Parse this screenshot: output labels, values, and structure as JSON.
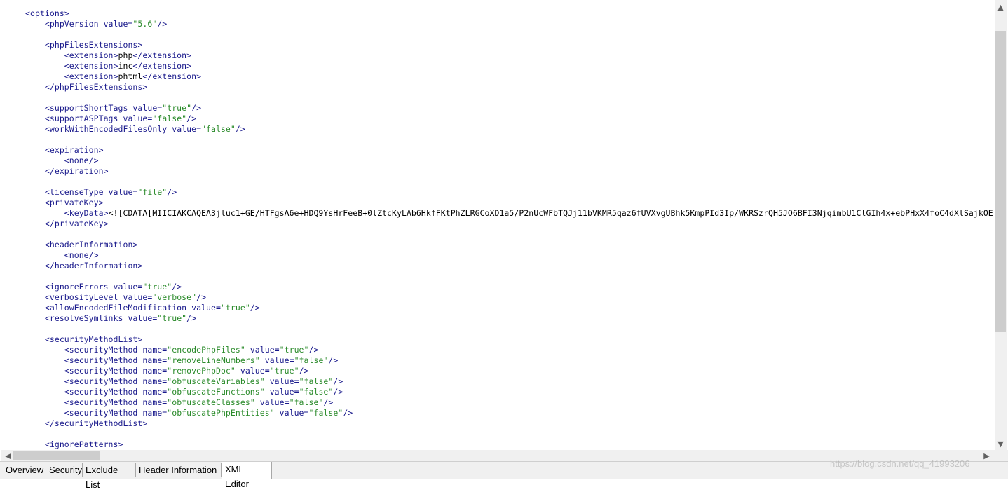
{
  "xml_lines": [
    [
      {
        "c": "t",
        "s": "<options>"
      }
    ],
    [
      {
        "c": "t",
        "s": "    <phpVersion "
      },
      {
        "c": "t",
        "s": "value="
      },
      {
        "c": "v",
        "s": "\"5.6\""
      },
      {
        "c": "t",
        "s": "/>"
      }
    ],
    [],
    [
      {
        "c": "t",
        "s": "    <phpFilesExtensions>"
      }
    ],
    [
      {
        "c": "t",
        "s": "        <extension>"
      },
      {
        "c": "txt",
        "s": "php"
      },
      {
        "c": "t",
        "s": "</extension>"
      }
    ],
    [
      {
        "c": "t",
        "s": "        <extension>"
      },
      {
        "c": "txt",
        "s": "inc"
      },
      {
        "c": "t",
        "s": "</extension>"
      }
    ],
    [
      {
        "c": "t",
        "s": "        <extension>"
      },
      {
        "c": "txt",
        "s": "phtml"
      },
      {
        "c": "t",
        "s": "</extension>"
      }
    ],
    [
      {
        "c": "t",
        "s": "    </phpFilesExtensions>"
      }
    ],
    [],
    [
      {
        "c": "t",
        "s": "    <supportShortTags "
      },
      {
        "c": "t",
        "s": "value="
      },
      {
        "c": "v",
        "s": "\"true\""
      },
      {
        "c": "t",
        "s": "/>"
      }
    ],
    [
      {
        "c": "t",
        "s": "    <supportASPTags "
      },
      {
        "c": "t",
        "s": "value="
      },
      {
        "c": "v",
        "s": "\"false\""
      },
      {
        "c": "t",
        "s": "/>"
      }
    ],
    [
      {
        "c": "t",
        "s": "    <workWithEncodedFilesOnly "
      },
      {
        "c": "t",
        "s": "value="
      },
      {
        "c": "v",
        "s": "\"false\""
      },
      {
        "c": "t",
        "s": "/>"
      }
    ],
    [],
    [
      {
        "c": "t",
        "s": "    <expiration>"
      }
    ],
    [
      {
        "c": "t",
        "s": "        <none/>"
      }
    ],
    [
      {
        "c": "t",
        "s": "    </expiration>"
      }
    ],
    [],
    [
      {
        "c": "t",
        "s": "    <licenseType "
      },
      {
        "c": "t",
        "s": "value="
      },
      {
        "c": "v",
        "s": "\"file\""
      },
      {
        "c": "t",
        "s": "/>"
      }
    ],
    [
      {
        "c": "t",
        "s": "    <privateKey>"
      }
    ],
    [
      {
        "c": "t",
        "s": "        <keyData>"
      },
      {
        "c": "txt",
        "s": "<![CDATA[MIICIAKCAQEA3jluc1+GE/HTFgsA6e+HDQ9YsHrFeeB+0lZtcKyLAb6HkfFKtPhZLRGCoXD1a5/P2nUcWFbTQJj11bVKMR5qaz6fUVXvgUBhk5KmpPId3Ip/WKRSzrQH5JO6BFI3NjqimbU1ClGIh4x+ebPHxX4foC4dXlSajkOE"
      }
    ],
    [
      {
        "c": "t",
        "s": "    </privateKey>"
      }
    ],
    [],
    [
      {
        "c": "t",
        "s": "    <headerInformation>"
      }
    ],
    [
      {
        "c": "t",
        "s": "        <none/>"
      }
    ],
    [
      {
        "c": "t",
        "s": "    </headerInformation>"
      }
    ],
    [],
    [
      {
        "c": "t",
        "s": "    <ignoreErrors "
      },
      {
        "c": "t",
        "s": "value="
      },
      {
        "c": "v",
        "s": "\"true\""
      },
      {
        "c": "t",
        "s": "/>"
      }
    ],
    [
      {
        "c": "t",
        "s": "    <verbosityLevel "
      },
      {
        "c": "t",
        "s": "value="
      },
      {
        "c": "v",
        "s": "\"verbose\""
      },
      {
        "c": "t",
        "s": "/>"
      }
    ],
    [
      {
        "c": "t",
        "s": "    <allowEncodedFileModification "
      },
      {
        "c": "t",
        "s": "value="
      },
      {
        "c": "v",
        "s": "\"true\""
      },
      {
        "c": "t",
        "s": "/>"
      }
    ],
    [
      {
        "c": "t",
        "s": "    <resolveSymlinks "
      },
      {
        "c": "t",
        "s": "value="
      },
      {
        "c": "v",
        "s": "\"true\""
      },
      {
        "c": "t",
        "s": "/>"
      }
    ],
    [],
    [
      {
        "c": "t",
        "s": "    <securityMethodList>"
      }
    ],
    [
      {
        "c": "t",
        "s": "        <securityMethod "
      },
      {
        "c": "t",
        "s": "name="
      },
      {
        "c": "v",
        "s": "\"encodePhpFiles\""
      },
      {
        "c": "t",
        "s": " value="
      },
      {
        "c": "v",
        "s": "\"true\""
      },
      {
        "c": "t",
        "s": "/>"
      }
    ],
    [
      {
        "c": "t",
        "s": "        <securityMethod "
      },
      {
        "c": "t",
        "s": "name="
      },
      {
        "c": "v",
        "s": "\"removeLineNumbers\""
      },
      {
        "c": "t",
        "s": " value="
      },
      {
        "c": "v",
        "s": "\"false\""
      },
      {
        "c": "t",
        "s": "/>"
      }
    ],
    [
      {
        "c": "t",
        "s": "        <securityMethod "
      },
      {
        "c": "t",
        "s": "name="
      },
      {
        "c": "v",
        "s": "\"removePhpDoc\""
      },
      {
        "c": "t",
        "s": " value="
      },
      {
        "c": "v",
        "s": "\"true\""
      },
      {
        "c": "t",
        "s": "/>"
      }
    ],
    [
      {
        "c": "t",
        "s": "        <securityMethod "
      },
      {
        "c": "t",
        "s": "name="
      },
      {
        "c": "v",
        "s": "\"obfuscateVariables\""
      },
      {
        "c": "t",
        "s": " value="
      },
      {
        "c": "v",
        "s": "\"false\""
      },
      {
        "c": "t",
        "s": "/>"
      }
    ],
    [
      {
        "c": "t",
        "s": "        <securityMethod "
      },
      {
        "c": "t",
        "s": "name="
      },
      {
        "c": "v",
        "s": "\"obfuscateFunctions\""
      },
      {
        "c": "t",
        "s": " value="
      },
      {
        "c": "v",
        "s": "\"false\""
      },
      {
        "c": "t",
        "s": "/>"
      }
    ],
    [
      {
        "c": "t",
        "s": "        <securityMethod "
      },
      {
        "c": "t",
        "s": "name="
      },
      {
        "c": "v",
        "s": "\"obfuscateClasses\""
      },
      {
        "c": "t",
        "s": " value="
      },
      {
        "c": "v",
        "s": "\"false\""
      },
      {
        "c": "t",
        "s": "/>"
      }
    ],
    [
      {
        "c": "t",
        "s": "        <securityMethod "
      },
      {
        "c": "t",
        "s": "name="
      },
      {
        "c": "v",
        "s": "\"obfuscatePhpEntities\""
      },
      {
        "c": "t",
        "s": " value="
      },
      {
        "c": "v",
        "s": "\"false\""
      },
      {
        "c": "t",
        "s": "/>"
      }
    ],
    [
      {
        "c": "t",
        "s": "    </securityMethodList>"
      }
    ],
    [],
    [
      {
        "c": "t",
        "s": "    <ignorePatterns>"
      }
    ]
  ],
  "scrollbars": {
    "up_arrow": "▲",
    "down_arrow": "▼",
    "left_arrow": "◀",
    "right_arrow": "▶"
  },
  "tabs": [
    {
      "label": "Overview",
      "active": false
    },
    {
      "label": "Security",
      "active": false
    },
    {
      "label": "Exclude List",
      "active": false
    },
    {
      "label": "Header Information",
      "active": false
    },
    {
      "label": "XML Editor",
      "active": true
    }
  ],
  "watermark": "https://blog.csdn.net/qq_41993206",
  "colors": {
    "tag": "#1a1a8c",
    "value": "#2a8a2a",
    "text": "#000000"
  }
}
